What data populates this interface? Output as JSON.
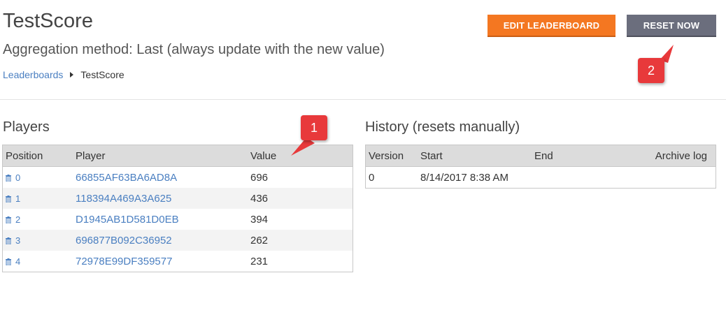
{
  "header": {
    "title": "TestScore",
    "subtitle": "Aggregation method: Last (always update with the new value)",
    "breadcrumb": {
      "parent": "Leaderboards",
      "current": "TestScore"
    }
  },
  "toolbar": {
    "edit_label": "EDIT LEADERBOARD",
    "reset_label": "RESET NOW"
  },
  "players": {
    "title": "Players",
    "columns": [
      "Position",
      "Player",
      "Value"
    ],
    "rows": [
      {
        "position": "0",
        "player": "66855AF63BA6AD8A",
        "value": "696"
      },
      {
        "position": "1",
        "player": "118394A469A3A625",
        "value": "436"
      },
      {
        "position": "2",
        "player": "D1945AB1D581D0EB",
        "value": "394"
      },
      {
        "position": "3",
        "player": "696877B092C36952",
        "value": "262"
      },
      {
        "position": "4",
        "player": "72978E99DF359577",
        "value": "231"
      }
    ]
  },
  "history": {
    "title": "History (resets manually)",
    "columns": [
      "Version",
      "Start",
      "End",
      "Archive log"
    ],
    "rows": [
      {
        "version": "0",
        "start": "8/14/2017 8:38 AM",
        "end": "",
        "archive": ""
      }
    ]
  },
  "annotations": {
    "badge1": "1",
    "badge2": "2"
  },
  "colors": {
    "accent_orange": "#f47721",
    "reset_gray": "#6b6e7d",
    "link_blue": "#4a7fc1",
    "badge_red": "#e8393b"
  }
}
